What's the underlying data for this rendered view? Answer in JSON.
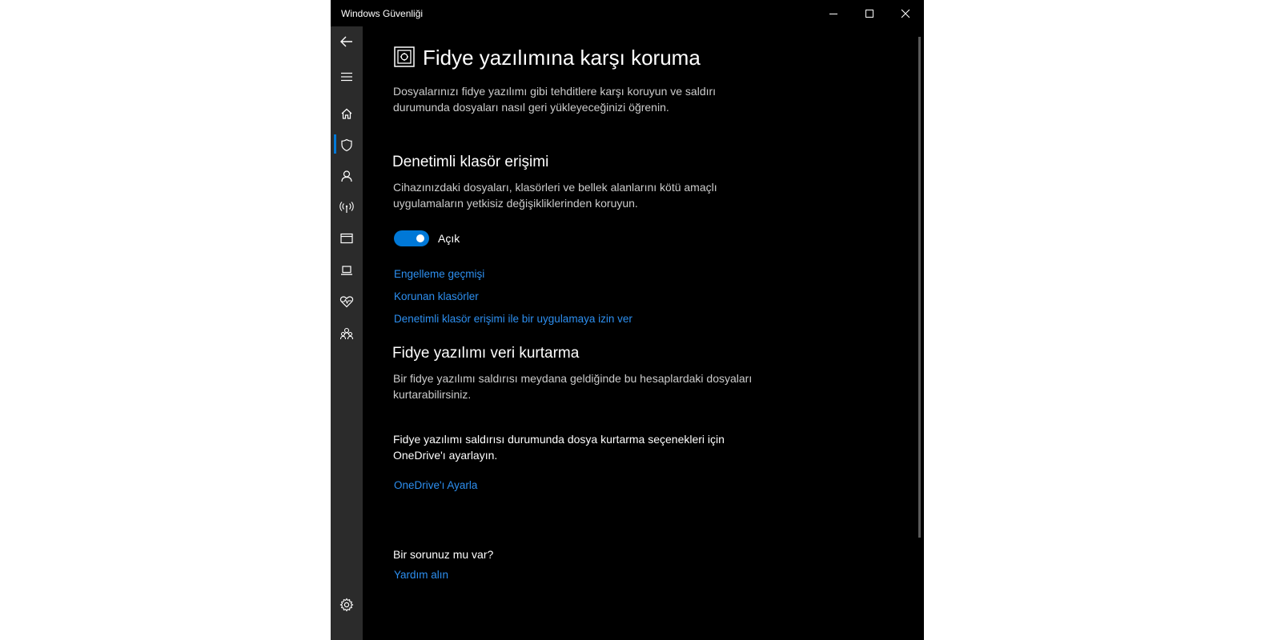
{
  "window": {
    "title": "Windows Güvenliği"
  },
  "nav": {
    "items": [
      {
        "icon": "back-arrow-icon"
      },
      {
        "icon": "hamburger-icon"
      },
      {
        "icon": "home-icon"
      },
      {
        "icon": "shield-icon",
        "selected": true
      },
      {
        "icon": "person-icon"
      },
      {
        "icon": "wifi-icon"
      },
      {
        "icon": "app-browser-icon"
      },
      {
        "icon": "laptop-icon"
      },
      {
        "icon": "heart-pulse-icon"
      },
      {
        "icon": "family-icon"
      },
      {
        "icon": "gear-icon"
      }
    ]
  },
  "page": {
    "title": "Fidye yazılımına karşı koruma",
    "description": "Dosyalarınızı fidye yazılımı gibi tehditlere karşı koruyun ve saldırı durumunda dosyaları nasıl geri yükleyeceğinizi öğrenin."
  },
  "cfa": {
    "title": "Denetimli klasör erişimi",
    "description": "Cihazınızdaki dosyaları, klasörleri ve bellek alanlarını kötü amaçlı uygulamaların yetkisiz değişikliklerinden koruyun.",
    "toggle_on": true,
    "toggle_label": "Açık",
    "links": {
      "block_history": "Engelleme geçmişi",
      "protected_folders": "Korunan klasörler",
      "allow_app": "Denetimli klasör erişimi ile bir uygulamaya izin ver"
    }
  },
  "recovery": {
    "title": "Fidye yazılımı veri kurtarma",
    "description": "Bir fidye yazılımı saldırısı meydana geldiğinde bu hesaplardaki dosyaları kurtarabilirsiniz.",
    "onedrive_text": "Fidye yazılımı saldırısı durumunda dosya kurtarma seçenekleri için OneDrive'ı ayarlayın.",
    "onedrive_link": "OneDrive'ı Ayarla"
  },
  "help": {
    "question": "Bir sorunuz mu var?",
    "link": "Yardım alın"
  },
  "colors": {
    "accent": "#0078d7",
    "link": "#2d8ff0",
    "background": "#000000",
    "nav_background": "#2b2b2b"
  }
}
